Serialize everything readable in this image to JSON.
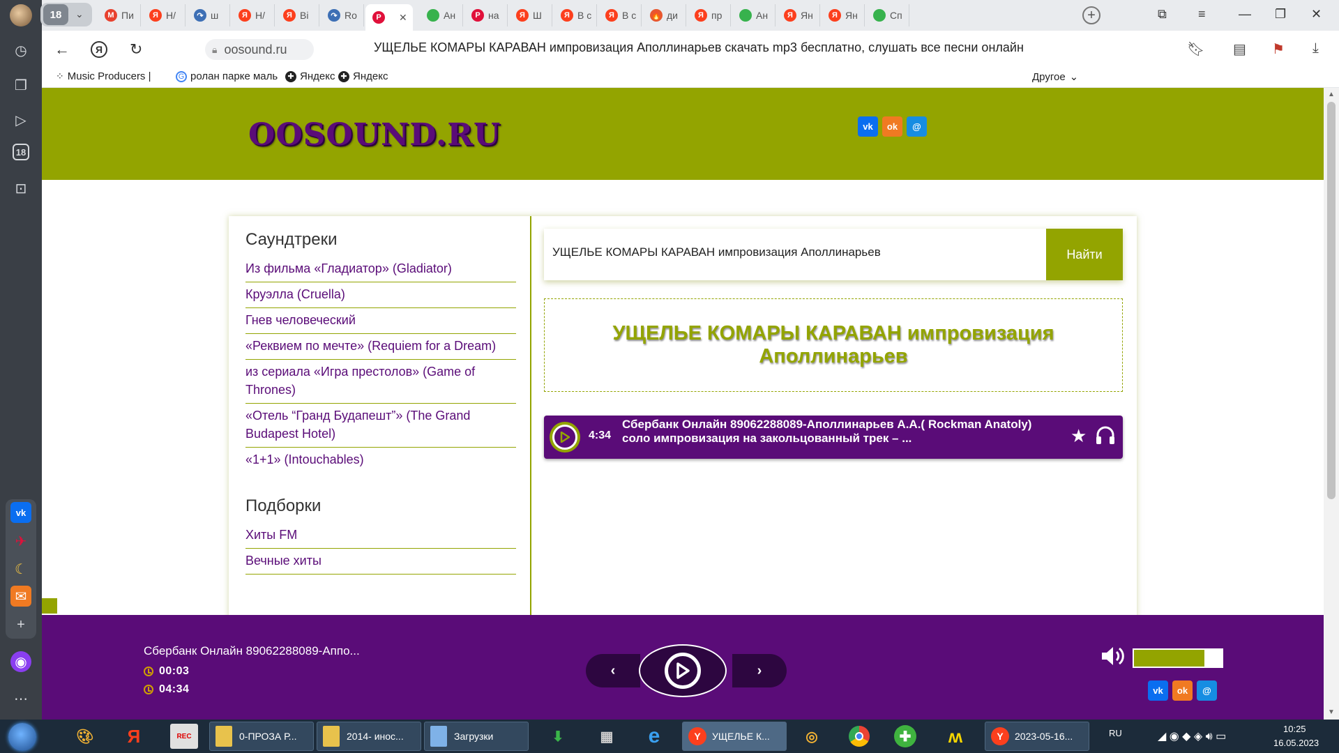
{
  "browser": {
    "tab_count": "18",
    "tabs": [
      {
        "label": "Пи",
        "color": "#e8412e",
        "glyph": "M"
      },
      {
        "label": "Н/",
        "color": "#fc3f1d",
        "glyph": "Я"
      },
      {
        "label": "ш",
        "color": "#3d6fb5",
        "glyph": "↷"
      },
      {
        "label": "Н/",
        "color": "#fc3f1d",
        "glyph": "Я"
      },
      {
        "label": "Ві",
        "color": "#fc3f1d",
        "glyph": "Я"
      },
      {
        "label": "Ro",
        "color": "#3d6fb5",
        "glyph": "↷"
      },
      {
        "label": "",
        "color": "#e0103a",
        "glyph": "P"
      },
      {
        "label": "Ан",
        "color": "#37b24d",
        "glyph": ""
      },
      {
        "label": "на",
        "color": "#e0103a",
        "glyph": "P"
      },
      {
        "label": "Ш",
        "color": "#fc3f1d",
        "glyph": "Я"
      },
      {
        "label": "В с",
        "color": "#fc3f1d",
        "glyph": "Я"
      },
      {
        "label": "В с",
        "color": "#fc3f1d",
        "glyph": "Я"
      },
      {
        "label": "ди",
        "color": "#e8572e",
        "glyph": "🔥"
      },
      {
        "label": "пр",
        "color": "#fc3f1d",
        "glyph": "Я"
      },
      {
        "label": "Ан",
        "color": "#37b24d",
        "glyph": ""
      },
      {
        "label": "Ян",
        "color": "#fc3f1d",
        "glyph": "Я"
      },
      {
        "label": "Ян",
        "color": "#fc3f1d",
        "glyph": "Я"
      },
      {
        "label": "Сп",
        "color": "#37b24d",
        "glyph": ""
      }
    ],
    "url": "oosound.ru",
    "page_title": "УЩЕЛЬЕ КОМАРЫ КАРАВАН импровизация Аполлинарьев скачать mp3 бесплатно, слушать все песни онлайн",
    "bookmarks": [
      "Music Producers |",
      "ролан парке маль",
      "Яндекс",
      "Яндекс"
    ],
    "other_bookmarks": "Другое"
  },
  "site": {
    "logo": "OOSOUND.RU",
    "social": {
      "vk": "vk",
      "ok": "ok",
      "mm": "@"
    },
    "sections": [
      {
        "title": "Саундтреки",
        "links": [
          "Из фильма «Гладиатор» (Gladiator)",
          "Круэлла (Cruella)",
          "Гнев человеческий",
          "«Реквием по мечте» (Requiem for a Dream)",
          "из сериала «Игра престолов» (Game of Thrones)",
          "«Отель “Гранд Будапешт”» (The Grand Budapest Hotel)",
          "«1+1» (Intouchables)"
        ]
      },
      {
        "title": "Подборки",
        "links": [
          "Хиты FM",
          "Вечные хиты"
        ]
      }
    ],
    "search_value": "УЩЕЛЬЕ КОМАРЫ КАРАВАН импровизация Аполлинарьев",
    "search_button": "Найти",
    "headline": "УЩЕЛЬЕ КОМАРЫ КАРАВАН импровизация Аполлинарьев",
    "track": {
      "duration": "4:34",
      "title": "Сбербанк Онлайн 89062288089-Аполлинарьев А.А.( Rockman Anatoly) соло импровизация на закольцованный трек – ..."
    },
    "player": {
      "title": "Сбербанк Онлайн 89062288089-Аппо...",
      "elapsed": "00:03",
      "total": "04:34",
      "volume_fraction": 0.8
    },
    "colors": {
      "accent": "#93a400",
      "brand": "#5a0c78"
    }
  },
  "taskbar": {
    "windows": [
      "0-ПРОЗА Р...",
      "2014- инос...",
      "Загрузки",
      "УЩЕЛЬЕ К...",
      "2023-05-16..."
    ],
    "language": "RU",
    "time": "10:25",
    "date": "16.05.2023"
  }
}
